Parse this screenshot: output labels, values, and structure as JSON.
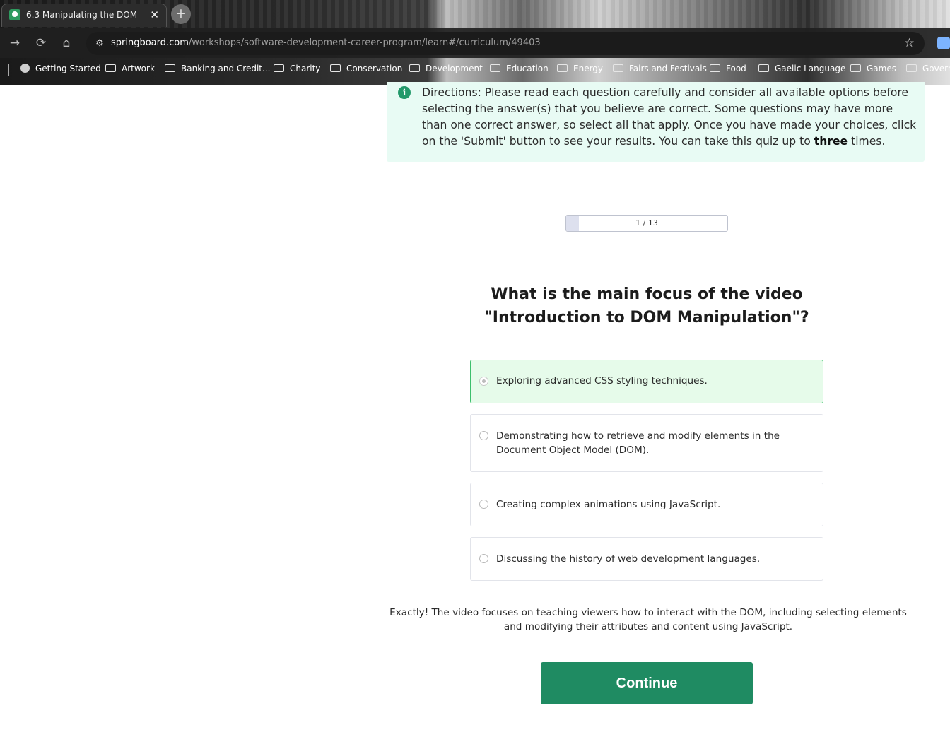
{
  "browser": {
    "tab": {
      "title": "6.3 Manipulating the DOM",
      "close": "✕"
    },
    "new_tab": "+",
    "nav": {
      "back": "→",
      "reload": "⟳",
      "home": "⌂"
    },
    "url": {
      "host": "springboard.com",
      "path": "/workshops/software-development-career-program/learn#/curriculum/49403"
    },
    "bookmark_star": "☆",
    "bookmarks": [
      {
        "label": "Getting Started",
        "type": "site"
      },
      {
        "label": "Artwork",
        "type": "folder"
      },
      {
        "label": "Banking and Credit...",
        "type": "folder"
      },
      {
        "label": "Charity",
        "type": "folder"
      },
      {
        "label": "Conservation",
        "type": "folder"
      },
      {
        "label": "Development",
        "type": "folder"
      },
      {
        "label": "Education",
        "type": "folder"
      },
      {
        "label": "Energy",
        "type": "folder"
      },
      {
        "label": "Fairs and Festivals",
        "type": "folder"
      },
      {
        "label": "Food",
        "type": "folder"
      },
      {
        "label": "Gaelic Language",
        "type": "folder"
      },
      {
        "label": "Games",
        "type": "folder"
      },
      {
        "label": "Govern",
        "type": "folder"
      }
    ]
  },
  "quiz": {
    "directions": {
      "icon": "i",
      "text_before": "Directions: Please read each question carefully and consider all available options before selecting the answer(s) that you believe are correct. Some questions may have more than one correct answer, so select all that apply. Once you have made your choices, click on the 'Submit' button to see your results. You can take this quiz up to ",
      "emphasis": "three",
      "text_after": " times."
    },
    "progress": {
      "label": "1 / 13",
      "current": 1,
      "total": 13,
      "fraction": 0.077
    },
    "question": "What is the main focus of the video \"Introduction to DOM Manipulation\"?",
    "options": [
      {
        "text": "Exploring advanced CSS styling techniques.",
        "selected": true
      },
      {
        "text": "Demonstrating how to retrieve and modify elements in the Document Object Model (DOM).",
        "selected": false
      },
      {
        "text": "Creating complex animations using JavaScript.",
        "selected": false
      },
      {
        "text": "Discussing the history of web development languages.",
        "selected": false
      }
    ],
    "feedback": "Exactly! The video focuses on teaching viewers how to interact with the DOM, including selecting elements and modifying their attributes and content using JavaScript.",
    "continue_label": "Continue"
  },
  "colors": {
    "accent": "#1f8b62",
    "info_bg": "#e8fbf4",
    "selected_bg": "#e6fbea",
    "selected_border": "#3cbf6c"
  }
}
